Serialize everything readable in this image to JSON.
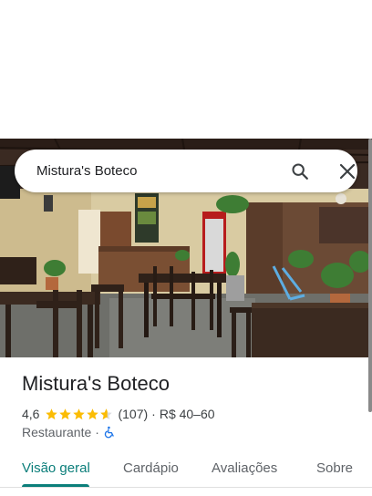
{
  "search": {
    "value": "Mistura's Boteco"
  },
  "place": {
    "title": "Mistura's Boteco",
    "rating": "4,6",
    "rating_value": 4.6,
    "review_count": "(107)",
    "separator": "·",
    "price": "R$ 40–60",
    "category": "Restaurante",
    "category_separator": "·"
  },
  "tabs": [
    {
      "label": "Visão geral",
      "active": true
    },
    {
      "label": "Cardápio",
      "active": false
    },
    {
      "label": "Avaliações",
      "active": false
    },
    {
      "label": "Sobre",
      "active": false
    }
  ],
  "colors": {
    "accent": "#0b7e7a",
    "star": "#fbbc04",
    "accessibility_icon": "#1a73e8"
  }
}
